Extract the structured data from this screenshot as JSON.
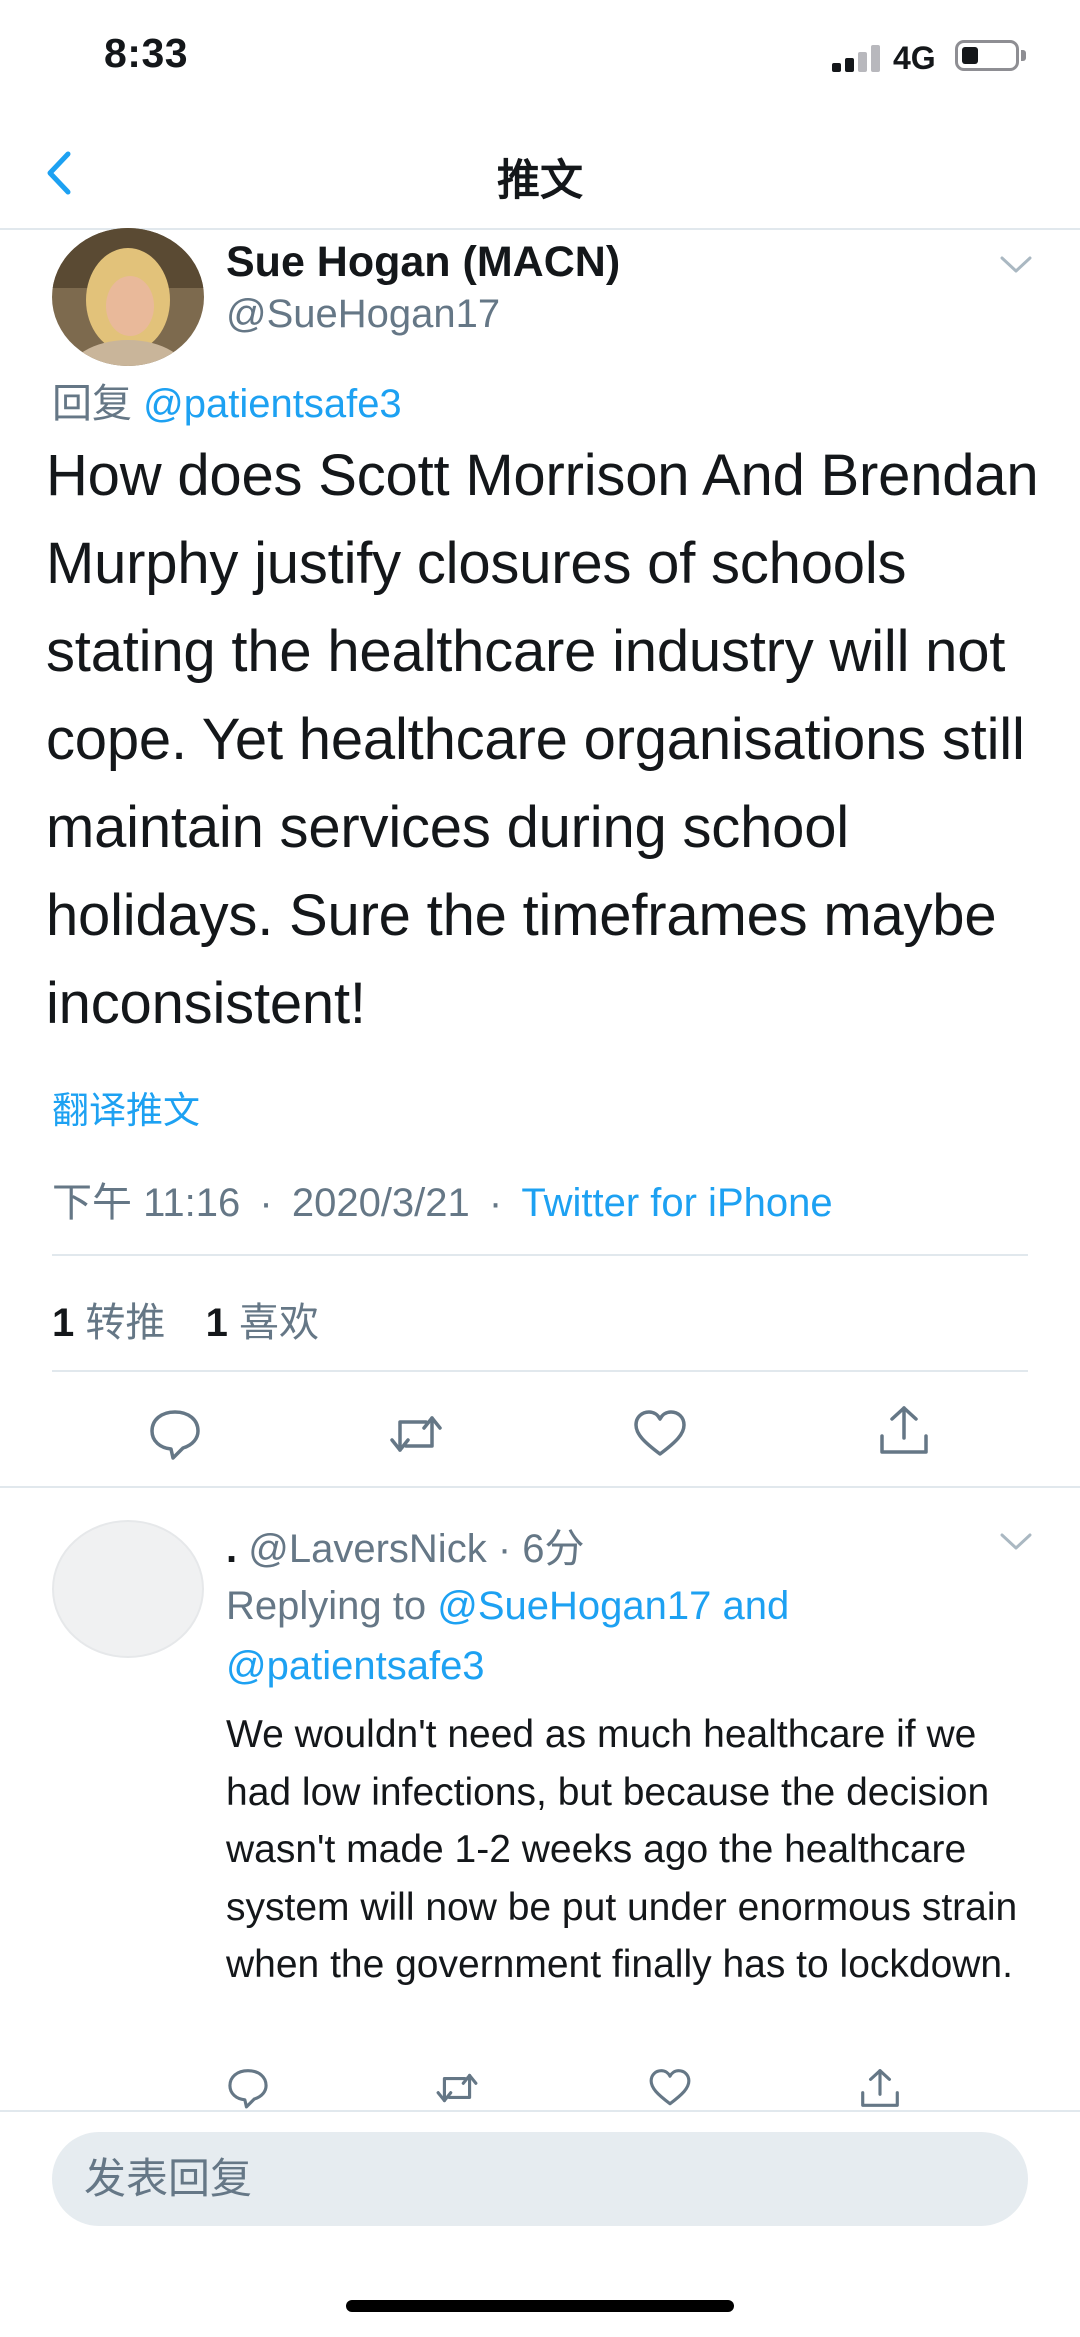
{
  "status_bar": {
    "time": "8:33",
    "network": "4G",
    "battery_level": 0.2
  },
  "nav": {
    "title": "推文",
    "back_icon": "chevron-left-icon"
  },
  "tweet": {
    "display_name": "Sue Hogan (MACN)",
    "handle": "@SueHogan17",
    "reply_prefix": "回复",
    "reply_to": "@patientsafe3",
    "text": "How does Scott Morrison And Brendan Murphy justify closures of schools stating the healthcare industry will not cope. Yet healthcare organisations still maintain services during school holidays. Sure the timeframes maybe inconsistent!",
    "translate_label": "翻译推文",
    "time": "下午 11:16",
    "date": "2020/3/21",
    "separator": "·",
    "source": "Twitter for iPhone",
    "retweets_count": "1",
    "retweets_label": "转推",
    "likes_count": "1",
    "likes_label": "喜欢"
  },
  "actions": {
    "reply_icon": "reply-icon",
    "retweet_icon": "retweet-icon",
    "like_icon": "heart-icon",
    "share_icon": "share-icon"
  },
  "reply": {
    "display_name": ".",
    "handle": "@LaversNick",
    "separator": "·",
    "time": "6分",
    "replying_label": "Replying to",
    "replying_user1": "@SueHogan17",
    "replying_and": "and",
    "replying_user2": "@patientsafe3",
    "text": "We wouldn't need as much healthcare if we had low infections, but because the decision wasn't made 1-2 weeks ago the healthcare system will now be put under enormous strain when the government finally has to lockdown."
  },
  "compose": {
    "placeholder": "发表回复"
  },
  "colors": {
    "accent": "#1da1f2",
    "secondary_text": "#657786",
    "divider": "#e1e8ed",
    "input_bg": "#e6ecf0"
  }
}
